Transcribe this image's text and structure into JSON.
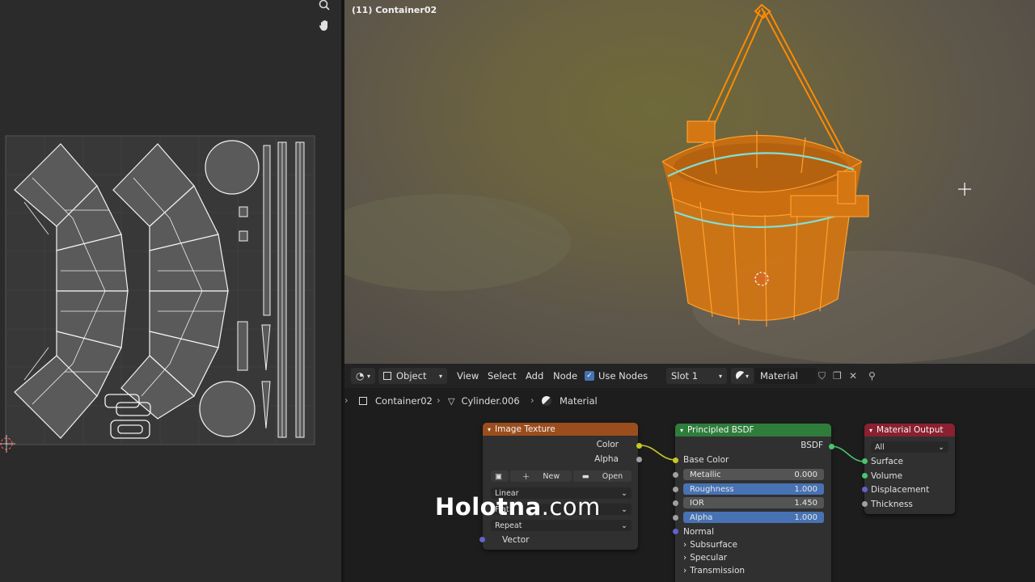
{
  "viewport": {
    "object_label": "(11) Container02"
  },
  "node_header": {
    "mode_label": "Object",
    "menu_view": "View",
    "menu_select": "Select",
    "menu_add": "Add",
    "menu_node": "Node",
    "use_nodes_label": "Use Nodes",
    "slot_label": "Slot 1",
    "material_name": "Material"
  },
  "breadcrumb": {
    "object": "Container02",
    "mesh": "Cylinder.006",
    "material": "Material"
  },
  "nodes": {
    "image_texture": {
      "title": "Image Texture",
      "out_color": "Color",
      "out_alpha": "Alpha",
      "new_label": "New",
      "open_label": "Open",
      "interpolation": "Linear",
      "projection": "Flat",
      "extension": "Repeat",
      "in_vector": "Vector"
    },
    "principled": {
      "title": "Principled BSDF",
      "out_bsdf": "BSDF",
      "base_color": "Base Color",
      "metallic_label": "Metallic",
      "metallic_value": "0.000",
      "roughness_label": "Roughness",
      "roughness_value": "1.000",
      "ior_label": "IOR",
      "ior_value": "1.450",
      "alpha_label": "Alpha",
      "alpha_value": "1.000",
      "normal": "Normal",
      "subsurface": "Subsurface",
      "specular": "Specular",
      "transmission": "Transmission"
    },
    "material_output": {
      "title": "Material Output",
      "target": "All",
      "surface": "Surface",
      "volume": "Volume",
      "displacement": "Displacement",
      "thickness": "Thickness"
    }
  },
  "watermark": {
    "brand": "Holotna",
    "domain": ".com"
  },
  "colors": {
    "accent_blue": "#4772b3",
    "texture_node": "#9b4e1d",
    "shader_node": "#2e7d3a",
    "output_node": "#8a2030",
    "selection_orange": "#ff8a00"
  }
}
